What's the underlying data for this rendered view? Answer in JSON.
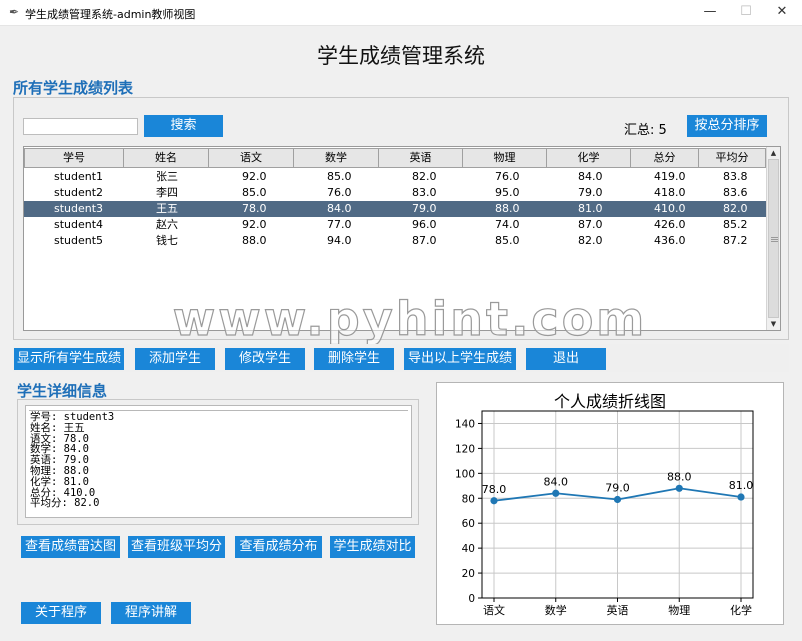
{
  "window": {
    "title": "学生成绩管理系统-admin教师视图",
    "min": "—",
    "max": "☐",
    "close": "✕"
  },
  "app_title": "学生成绩管理系统",
  "list_section": {
    "label": "所有学生成绩列表",
    "search_value": "",
    "search_button": "搜索",
    "total_label": "汇总: 5",
    "sort_button": "按总分排序"
  },
  "table": {
    "columns": [
      "学号",
      "姓名",
      "语文",
      "数学",
      "英语",
      "物理",
      "化学",
      "总分",
      "平均分"
    ],
    "rows": [
      [
        "student1",
        "张三",
        "92.0",
        "85.0",
        "82.0",
        "76.0",
        "84.0",
        "419.0",
        "83.8"
      ],
      [
        "student2",
        "李四",
        "85.0",
        "76.0",
        "83.0",
        "95.0",
        "79.0",
        "418.0",
        "83.6"
      ],
      [
        "student3",
        "王五",
        "78.0",
        "84.0",
        "79.0",
        "88.0",
        "81.0",
        "410.0",
        "82.0"
      ],
      [
        "student4",
        "赵六",
        "92.0",
        "77.0",
        "96.0",
        "74.0",
        "87.0",
        "426.0",
        "85.2"
      ],
      [
        "student5",
        "钱七",
        "88.0",
        "94.0",
        "87.0",
        "85.0",
        "82.0",
        "436.0",
        "87.2"
      ]
    ],
    "selected_row": 2
  },
  "actions": {
    "show_all": "显示所有学生成绩",
    "add": "添加学生",
    "edit": "修改学生",
    "delete": "删除学生",
    "export": "导出以上学生成绩",
    "exit": "退出"
  },
  "detail": {
    "label": "学生详细信息",
    "lines": [
      "学号: student3",
      "姓名: 王五",
      "语文: 78.0",
      "数学: 84.0",
      "英语: 79.0",
      "物理: 88.0",
      "化学: 81.0",
      "总分: 410.0",
      "平均分: 82.0"
    ]
  },
  "analysis": {
    "radar": "查看成绩雷达图",
    "class_avg": "查看班级平均分",
    "distribution": "查看成绩分布",
    "compare": "学生成绩对比"
  },
  "footer": {
    "about": "关于程序",
    "explain": "程序讲解"
  },
  "watermark": "www.pyhint.com",
  "colors": {
    "accent": "#1a86d8",
    "selected_row": "#506a85",
    "section_label": "#1e6fb8",
    "line": "#1f77b4"
  },
  "chart_data": {
    "type": "line",
    "title": "个人成绩折线图",
    "categories": [
      "语文",
      "数学",
      "英语",
      "物理",
      "化学"
    ],
    "values": [
      78.0,
      84.0,
      79.0,
      88.0,
      81.0
    ],
    "data_labels": [
      "78.0",
      "84.0",
      "79.0",
      "88.0",
      "81.0"
    ],
    "yticks": [
      0,
      20,
      40,
      60,
      80,
      100,
      120,
      140
    ],
    "ylim": [
      0,
      150
    ],
    "grid": true,
    "xlabel": "",
    "ylabel": ""
  }
}
